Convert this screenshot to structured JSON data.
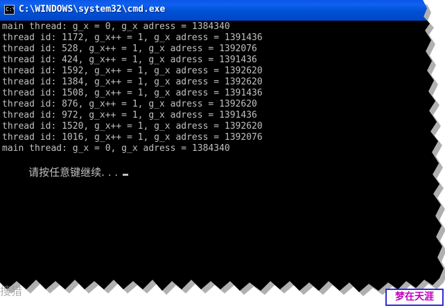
{
  "window": {
    "title": "C:\\WINDOWS\\system32\\cmd.exe",
    "icon_name": "cmd-icon",
    "icon_glyph": "C:\\"
  },
  "console": {
    "lines": [
      "main thread: g_x = 0, g_x adress = 1384340",
      "thread id: 1172, g_x++ = 1, g_x adress = 1391436",
      "thread id: 528, g_x++ = 1, g_x adress = 1392076",
      "thread id: 424, g_x++ = 1, g_x adress = 1391436",
      "thread id: 1592, g_x++ = 1, g_x adress = 1392620",
      "thread id: 1384, g_x++ = 1, g_x adress = 1392620",
      "thread id: 1508, g_x++ = 1, g_x adress = 1391436",
      "thread id: 876, g_x++ = 1, g_x adress = 1392620",
      "thread id: 972, g_x++ = 1, g_x adress = 1391436",
      "thread id: 1520, g_x++ = 1, g_x adress = 1392620",
      "thread id: 1016, g_x++ = 1, g_x adress = 1392076",
      "main thread: g_x = 0, g_x adress = 1384340"
    ],
    "prompt": "请按任意键继续. . . "
  },
  "watermark": {
    "left_text": "搜猎"
  },
  "brand": {
    "badge_text": "梦在天涯"
  },
  "colors": {
    "titlebar_blue": "#0051d6",
    "console_bg": "#000000",
    "console_text": "#c0c0c0",
    "badge_text": "#c000c0",
    "badge_border": "#2b2bd6"
  }
}
